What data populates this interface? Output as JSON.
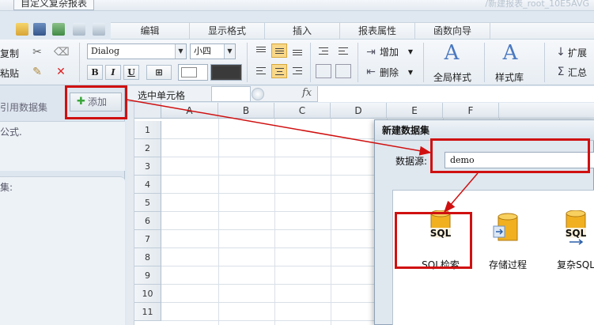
{
  "title_bar": {
    "doc_tab": "自定义复杂报表",
    "doc_name": "/新建报表_root_10E5AVG"
  },
  "tabs": [
    "编辑",
    "显示格式",
    "插入",
    "报表属性",
    "函数向导"
  ],
  "ribbon": {
    "copy_label": "复制",
    "paste_label": "粘贴",
    "font_name": "Dialog",
    "font_size": "小四",
    "bold": "B",
    "italic": "I",
    "underline": "U",
    "add_label": "增加",
    "delete_label": "删除",
    "global_style_label": "全局样式",
    "style_lib_label": "样式库",
    "expand_label": "扩展",
    "summary_label": "汇总"
  },
  "left_panel": {
    "tab_label": "引用数据集",
    "add_button": "添加",
    "formula_hint": "公式.",
    "dataset_hint": "集:"
  },
  "formula_bar": {
    "label": "选中单元格",
    "fx": "fx"
  },
  "grid": {
    "columns": [
      "A",
      "B",
      "C",
      "D",
      "E",
      "F"
    ],
    "rows": [
      "1",
      "2",
      "3",
      "4",
      "5",
      "6",
      "7",
      "8",
      "9",
      "10",
      "11"
    ]
  },
  "dialog": {
    "title": "新建数据集",
    "datasource_label": "数据源:",
    "datasource_value": "demo",
    "items": [
      {
        "label": "SQL检索",
        "icon": "sql-db-icon",
        "badge": "SQL"
      },
      {
        "label": "存储过程",
        "icon": "stored-procedure-icon",
        "badge": ""
      },
      {
        "label": "复杂SQL",
        "icon": "complex-sql-icon",
        "badge": "SQL"
      }
    ]
  },
  "colors": {
    "highlight": "#d01010",
    "accent_yellow": "#f0b020"
  }
}
